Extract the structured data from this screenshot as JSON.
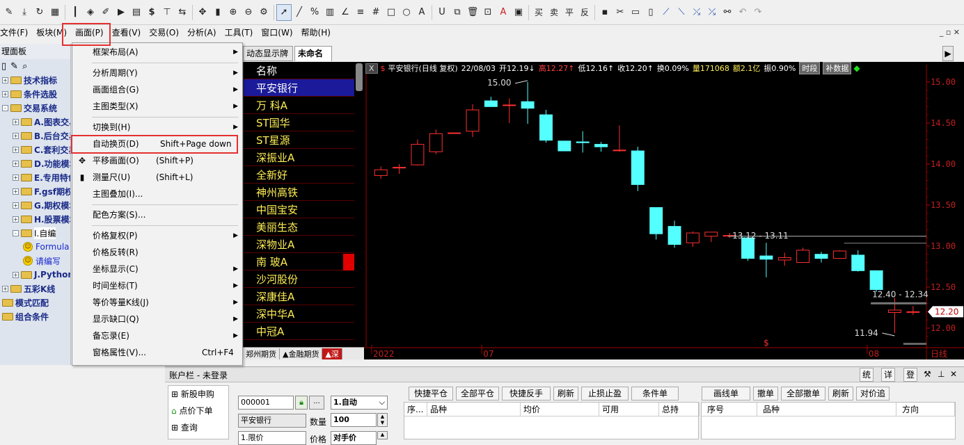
{
  "toolbar": {
    "icons": [
      "pencil-icon",
      "download-icon",
      "refresh-icon",
      "grid-icon",
      "candle-icon",
      "diamond-icon",
      "edit-icon",
      "play-icon",
      "doc-icon",
      "dollar-icon",
      "filter-icon",
      "swap-icon",
      "move-icon",
      "ruler-icon",
      "zoom-in-icon",
      "zoom-out-icon",
      "gear-icon",
      "cursor-icon",
      "line-icon",
      "percent-icon",
      "bars-icon",
      "angle-icon",
      "hlines-icon",
      "hash-icon",
      "rect-icon",
      "ellipse-icon",
      "text-icon",
      "magnet-icon",
      "copy-icon",
      "trash-icon",
      "lock-icon",
      "font-color-icon",
      "save-box-icon"
    ],
    "text_buttons": [
      "买",
      "卖",
      "平",
      "反"
    ],
    "right_icons": [
      "disk-icon",
      "cut-icon",
      "paste-icon",
      "clipboard-icon",
      "tool1-icon",
      "tool2-icon",
      "tool3-icon",
      "tool4-icon",
      "binoculars-icon",
      "undo-icon",
      "redo-icon"
    ]
  },
  "menubar": {
    "items": [
      "文件(F)",
      "板块(M)",
      "画面(P)",
      "查看(V)",
      "交易(O)",
      "分析(A)",
      "工具(T)",
      "窗口(W)",
      "帮助(H)"
    ],
    "right_controls": "_ ▫ ✕"
  },
  "panel": {
    "title": "理面板",
    "tools": [
      "new-doc-icon",
      "edit-doc-icon",
      "search-icon"
    ],
    "items": [
      {
        "label": "技术指标",
        "level": 0,
        "exp": "+"
      },
      {
        "label": "条件选股",
        "level": 0,
        "exp": "+"
      },
      {
        "label": "交易系统",
        "level": 0,
        "exp": "-"
      },
      {
        "label": "A.图表交易",
        "level": 1,
        "exp": "+"
      },
      {
        "label": "B.后台交易",
        "level": 1,
        "exp": "+"
      },
      {
        "label": "C.套利交易",
        "level": 1,
        "exp": "+"
      },
      {
        "label": "D.功能模块",
        "level": 1,
        "exp": "+"
      },
      {
        "label": "E.专用特色",
        "level": 1,
        "exp": "+"
      },
      {
        "label": "F.gsf期权",
        "level": 1,
        "exp": "+"
      },
      {
        "label": "G.期权模块",
        "level": 1,
        "exp": "+"
      },
      {
        "label": "H.股票模块",
        "level": 1,
        "exp": "+"
      },
      {
        "label": "I.自编",
        "level": 1,
        "exp": "-"
      },
      {
        "label": "Formula",
        "level": 2,
        "exp": ""
      },
      {
        "label": "请编写",
        "level": 2,
        "exp": ""
      },
      {
        "label": "J.Python",
        "level": 1,
        "exp": "+"
      },
      {
        "label": "五彩K线",
        "level": 0,
        "exp": "+"
      },
      {
        "label": "模式匹配",
        "level": 0,
        "exp": ""
      },
      {
        "label": "组合条件",
        "level": 0,
        "exp": ""
      }
    ]
  },
  "dropdown": {
    "items": [
      {
        "label": "框架布局(A)",
        "shortcut": "",
        "arrow": true,
        "icon": ""
      },
      {
        "sep": true
      },
      {
        "label": "分析周期(Y)",
        "shortcut": "",
        "arrow": true,
        "icon": ""
      },
      {
        "label": "画面组合(G)",
        "shortcut": "",
        "arrow": true,
        "icon": ""
      },
      {
        "label": "主图类型(X)",
        "shortcut": "",
        "arrow": true,
        "icon": ""
      },
      {
        "sep": true
      },
      {
        "label": "切换到(H)",
        "shortcut": "",
        "arrow": true,
        "icon": ""
      },
      {
        "label": "自动换页(D)",
        "shortcut": "Shift+Page down",
        "arrow": false,
        "icon": ""
      },
      {
        "label": "平移画面(O)",
        "shortcut": "(Shift+P)",
        "arrow": false,
        "icon": "✥"
      },
      {
        "label": "测量尺(U)",
        "shortcut": "(Shift+L)",
        "arrow": false,
        "icon": "▮"
      },
      {
        "label": "主图叠加(I)...",
        "shortcut": "",
        "arrow": false,
        "icon": ""
      },
      {
        "sep": true
      },
      {
        "label": "配色方案(S)...",
        "shortcut": "",
        "arrow": false,
        "icon": ""
      },
      {
        "sep": true
      },
      {
        "label": "价格复权(P)",
        "shortcut": "",
        "arrow": true,
        "icon": ""
      },
      {
        "label": "价格反转(R)",
        "shortcut": "",
        "arrow": false,
        "icon": ""
      },
      {
        "label": "坐标显示(C)",
        "shortcut": "",
        "arrow": true,
        "icon": ""
      },
      {
        "label": "时间坐标(T)",
        "shortcut": "",
        "arrow": true,
        "icon": ""
      },
      {
        "label": "等价等量K线(J)",
        "shortcut": "",
        "arrow": true,
        "icon": ""
      },
      {
        "label": "显示缺口(Q)",
        "shortcut": "",
        "arrow": true,
        "icon": ""
      },
      {
        "label": "备忘录(E)",
        "shortcut": "",
        "arrow": true,
        "icon": ""
      },
      {
        "label": "窗格属性(V)...",
        "shortcut": "Ctrl+F4",
        "arrow": false,
        "icon": ""
      }
    ]
  },
  "tabs": [
    "动态显示牌",
    "未命名"
  ],
  "stocklist": {
    "header": "名称",
    "items": [
      "平安银行",
      "万 科A",
      "ST国华",
      "ST星源",
      "深振业A",
      "全新好",
      "神州高铁",
      "中国宝安",
      "美丽生态",
      "深物业A",
      "南 玻A",
      "沙河股份",
      "深康佳A",
      "深中华A",
      "中冠A"
    ],
    "selected": 0
  },
  "sheettabs": [
    "郑州期货",
    "▲金融期货",
    "▲深"
  ],
  "chart_info": {
    "xbtn": "X",
    "name": "平安银行(日线 复权)",
    "date": "22/08/03",
    "open": "开12.19↓",
    "high": "高12.27↑",
    "low": "低12.16↑",
    "close": "收12.20↑",
    "change": "换0.09%",
    "vol": "量171068",
    "amount": "额2.1亿",
    "amp": "振0.90%",
    "btn1": "时段",
    "btn2": "补数据"
  },
  "chart_data": {
    "type": "candlestick",
    "yticks": [
      15.0,
      14.5,
      14.0,
      13.5,
      13.0,
      12.5,
      12.0
    ],
    "ylim": [
      11.94,
      15.05
    ],
    "xticks": [
      {
        "label": "2022",
        "idx": 0
      },
      {
        "label": "07",
        "idx": 6
      },
      {
        "label": "08",
        "idx": 27
      }
    ],
    "xlabel_right": "日线",
    "candles": [
      {
        "o": 13.86,
        "h": 13.97,
        "l": 13.82,
        "c": 13.93
      },
      {
        "o": 13.96,
        "h": 14.0,
        "l": 13.88,
        "c": 13.96
      },
      {
        "o": 13.99,
        "h": 14.3,
        "l": 13.98,
        "c": 14.24
      },
      {
        "o": 14.15,
        "h": 14.42,
        "l": 14.12,
        "c": 14.37
      },
      {
        "o": 14.38,
        "h": 14.38,
        "l": 14.38,
        "c": 14.38
      },
      {
        "o": 14.4,
        "h": 14.73,
        "l": 14.33,
        "c": 14.66
      },
      {
        "o": 14.77,
        "h": 14.82,
        "l": 14.7,
        "c": 14.7
      },
      {
        "o": 14.72,
        "h": 14.8,
        "l": 14.5,
        "c": 14.72
      },
      {
        "o": 14.76,
        "h": 15.0,
        "l": 14.49,
        "c": 14.68
      },
      {
        "o": 14.6,
        "h": 14.66,
        "l": 14.26,
        "c": 14.29
      },
      {
        "o": 14.28,
        "h": 14.28,
        "l": 14.17,
        "c": 14.16
      },
      {
        "o": 14.27,
        "h": 14.4,
        "l": 14.14,
        "c": 14.26
      },
      {
        "o": 14.24,
        "h": 14.27,
        "l": 14.15,
        "c": 14.21
      },
      {
        "o": 14.17,
        "h": 14.47,
        "l": 14.15,
        "c": 14.17
      },
      {
        "o": 14.16,
        "h": 14.21,
        "l": 13.67,
        "c": 13.75
      },
      {
        "o": 13.47,
        "h": 13.47,
        "l": 13.08,
        "c": 13.15
      },
      {
        "o": 13.24,
        "h": 13.31,
        "l": 12.98,
        "c": 13.02
      },
      {
        "o": 13.04,
        "h": 13.18,
        "l": 12.99,
        "c": 13.16
      },
      {
        "o": 13.12,
        "h": 13.17,
        "l": 13.05,
        "c": 13.17
      },
      {
        "o": 13.12,
        "h": 13.16,
        "l": 13.1,
        "c": 13.13
      },
      {
        "o": 13.1,
        "h": 13.11,
        "l": 12.82,
        "c": 12.85
      },
      {
        "o": 12.88,
        "h": 13.04,
        "l": 12.62,
        "c": 12.84
      },
      {
        "o": 12.83,
        "h": 12.92,
        "l": 12.76,
        "c": 12.86
      },
      {
        "o": 12.8,
        "h": 12.98,
        "l": 12.8,
        "c": 12.95
      },
      {
        "o": 12.9,
        "h": 12.93,
        "l": 12.8,
        "c": 12.85
      },
      {
        "o": 12.85,
        "h": 12.95,
        "l": 12.85,
        "c": 12.94
      },
      {
        "o": 12.89,
        "h": 12.95,
        "l": 12.69,
        "c": 12.7
      },
      {
        "o": 12.7,
        "h": 12.7,
        "l": 12.44,
        "c": 12.47
      },
      {
        "o": 12.19,
        "h": 12.37,
        "l": 11.94,
        "c": 12.22
      },
      {
        "o": 12.2,
        "h": 12.27,
        "l": 12.16,
        "c": 12.2
      }
    ],
    "annotations": {
      "max": "15.00",
      "min": "11.94",
      "range1": "13.12 - 13.11",
      "range2": "12.40 - 12.34",
      "current": "12.20"
    }
  },
  "account": {
    "title": "账户栏 - 未登录",
    "buttons_right": [
      "统",
      "详",
      "登"
    ],
    "left_items": [
      "新股申购",
      "点价下单",
      "查询"
    ],
    "code": "000001",
    "auto": "1.自动",
    "name": "平安银行",
    "qty_label": "数量",
    "qty": "100",
    "order_type": "1.限价",
    "price_label": "价格",
    "price": "对手价",
    "actions1": [
      "快捷平仓",
      "全部平仓",
      "快捷反手",
      "刷新",
      "止损止盈",
      "条件单"
    ],
    "actions2": [
      "画线单",
      "撤单",
      "全部撤单",
      "刷新",
      "对价追"
    ],
    "cols1": [
      "序...",
      "品种",
      "均价",
      "可用",
      "总持"
    ],
    "cols2": [
      "序号",
      "品种",
      "方向"
    ]
  }
}
